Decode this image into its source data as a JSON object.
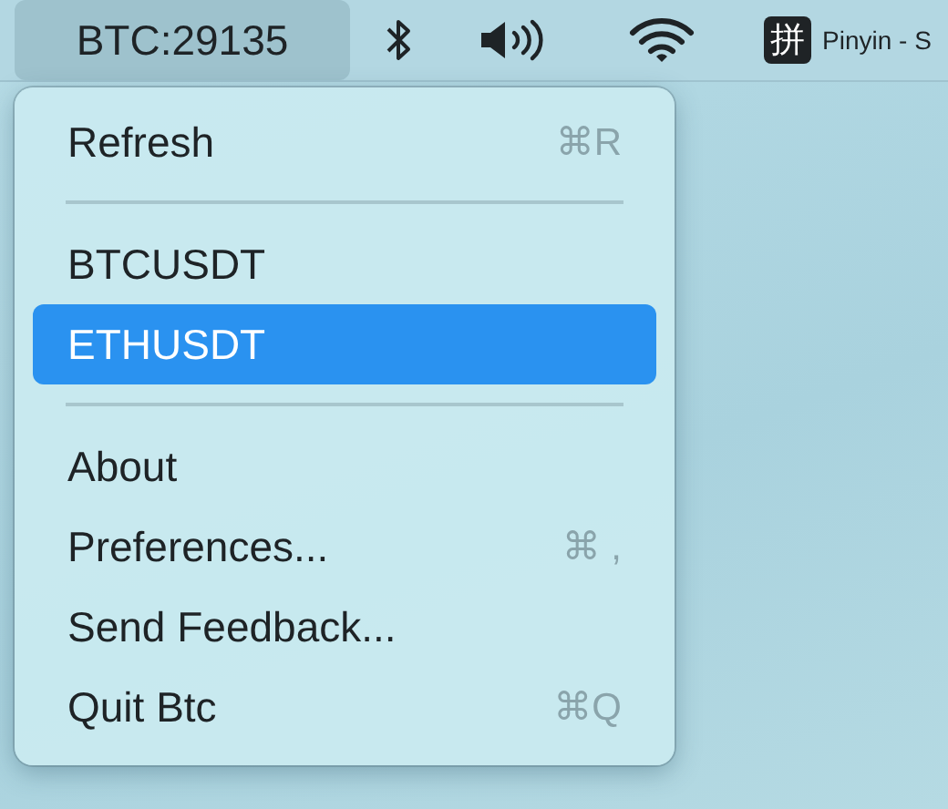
{
  "menu_bar": {
    "status_item": {
      "label": "BTC:29135",
      "selected": true
    },
    "input_source": {
      "glyph": "拼",
      "label": "Pinyin - S"
    }
  },
  "menu": {
    "items": [
      {
        "kind": "item",
        "label": "Refresh",
        "shortcut": "⌘R",
        "selected": false
      },
      {
        "kind": "separator"
      },
      {
        "kind": "item",
        "label": "BTCUSDT",
        "selected": false
      },
      {
        "kind": "item",
        "label": "ETHUSDT",
        "selected": true
      },
      {
        "kind": "separator"
      },
      {
        "kind": "item",
        "label": "About",
        "selected": false
      },
      {
        "kind": "item",
        "label": "Preferences...",
        "shortcut": "⌘ ,",
        "selected": false
      },
      {
        "kind": "item",
        "label": "Send Feedback...",
        "selected": false
      },
      {
        "kind": "item",
        "label": "Quit Btc",
        "shortcut": "⌘Q",
        "selected": false
      }
    ]
  }
}
